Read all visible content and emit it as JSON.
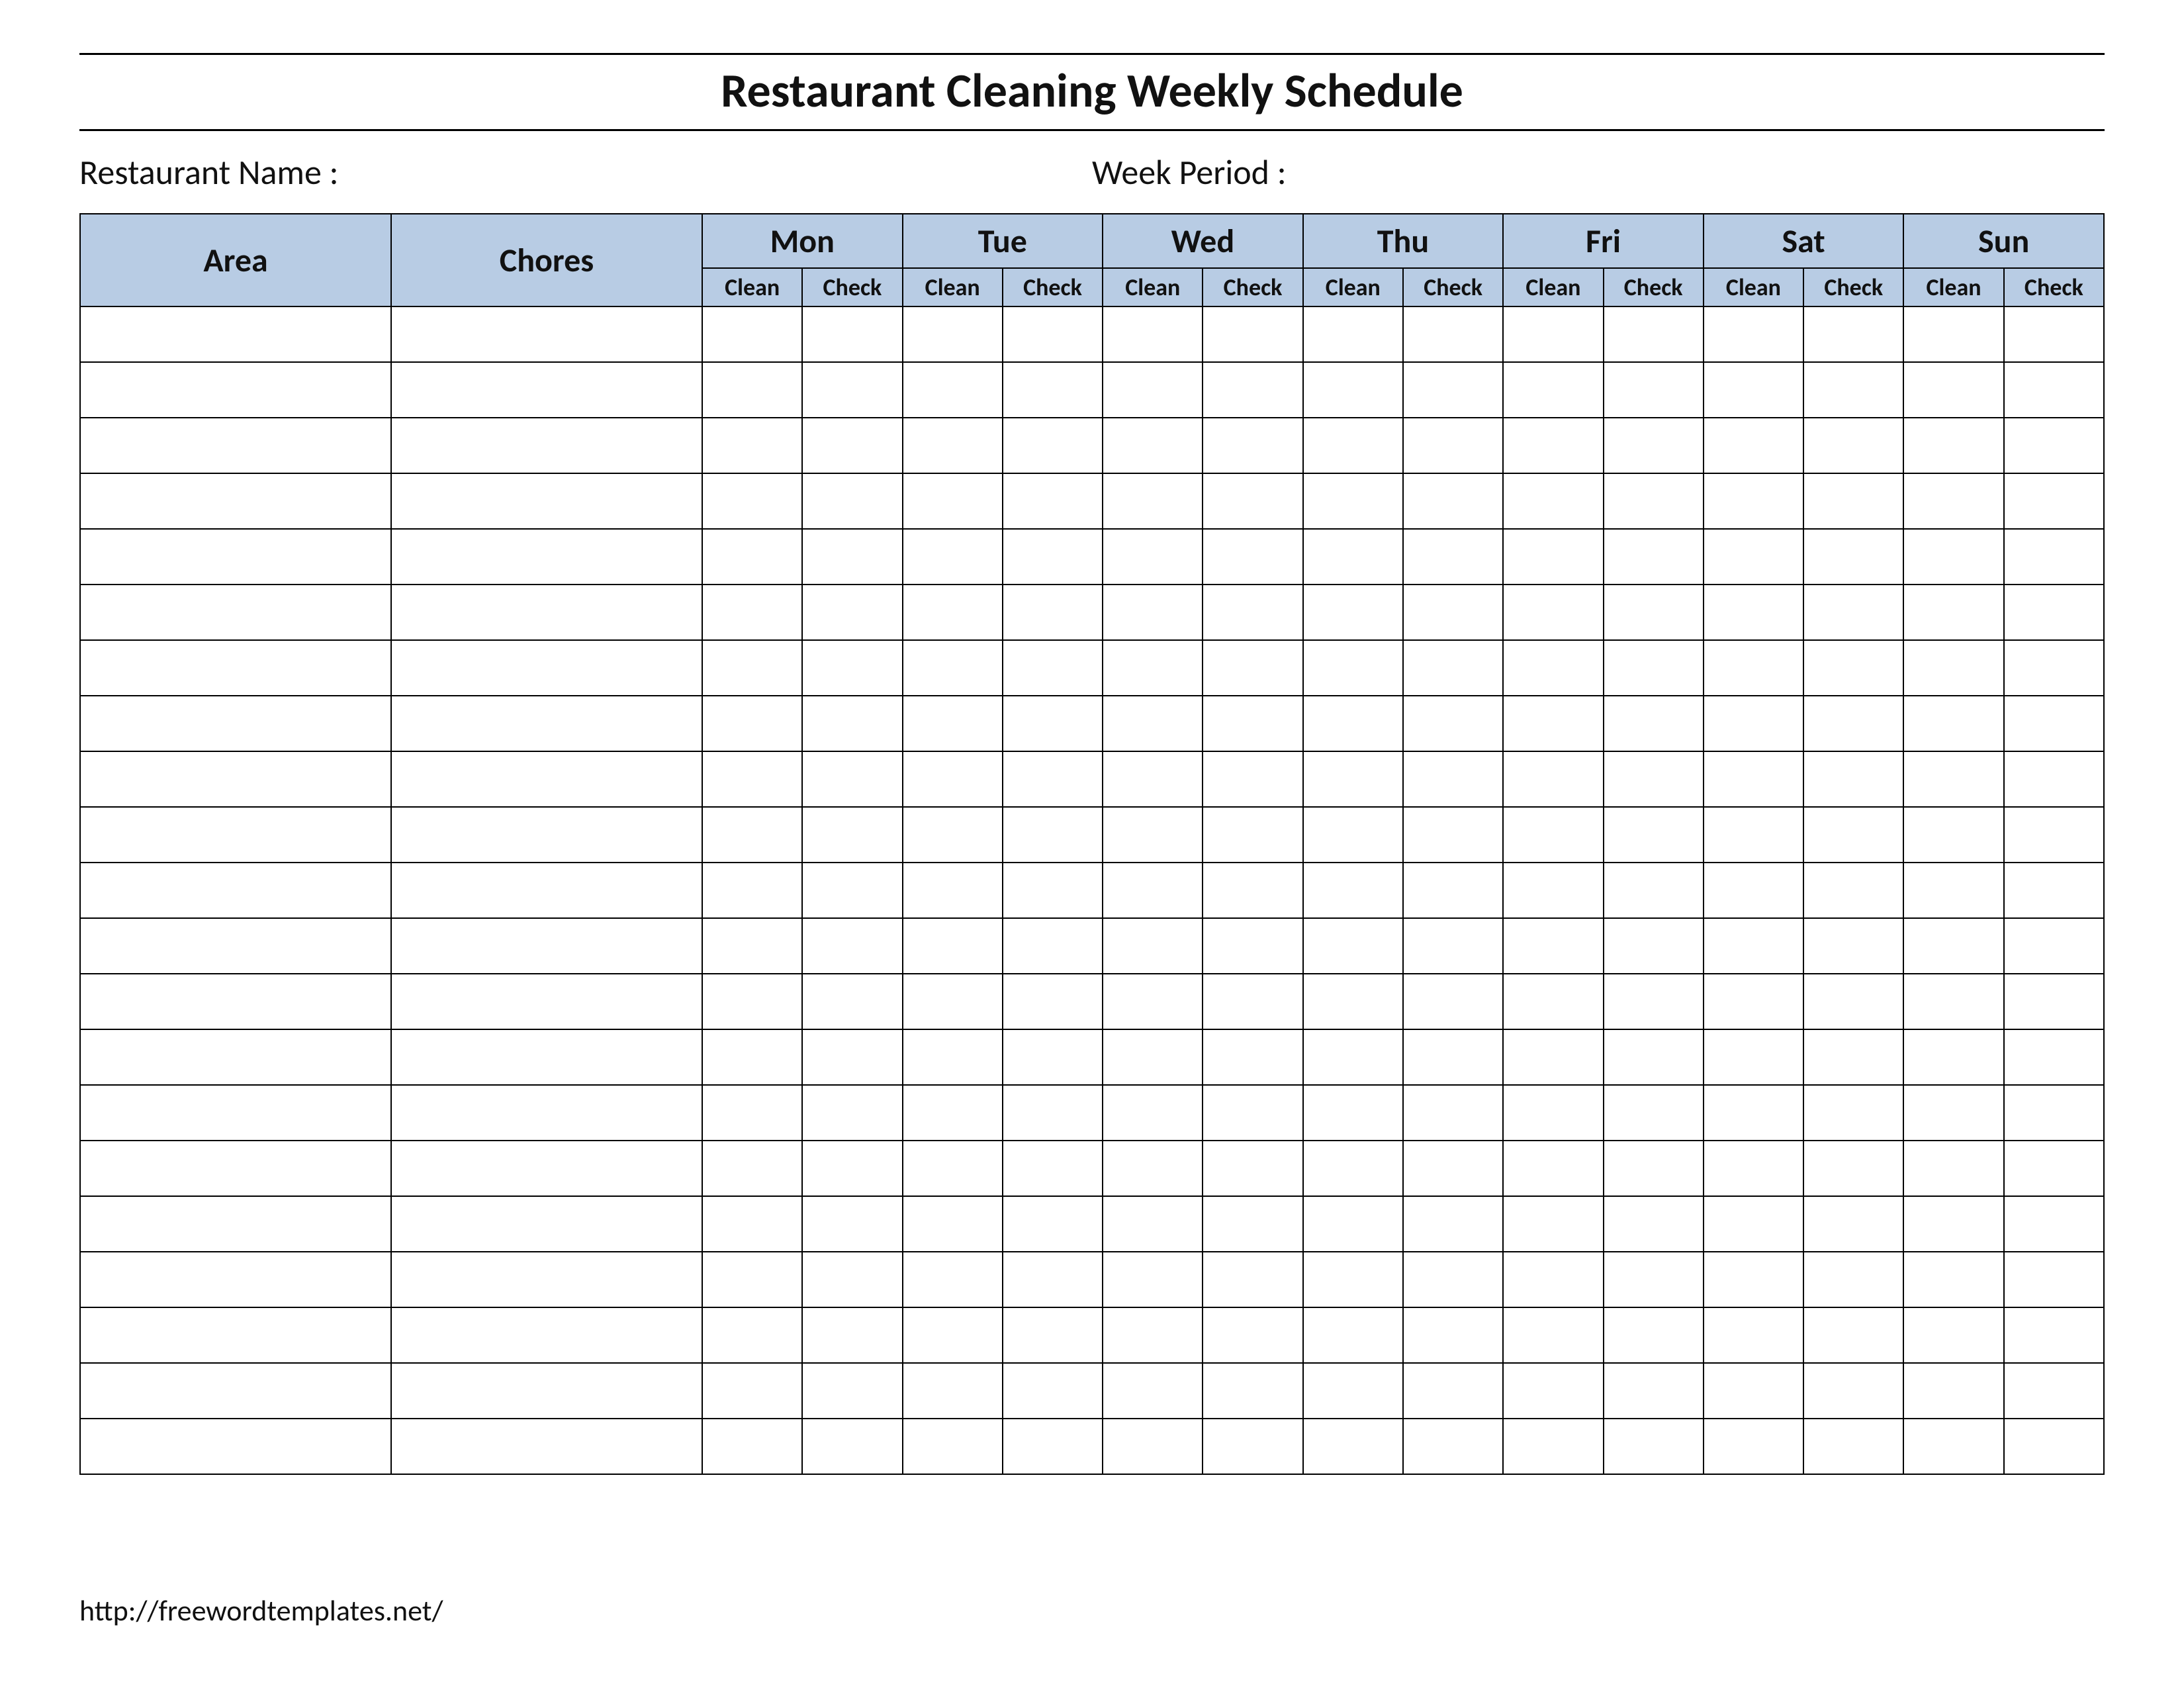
{
  "title": "Restaurant Cleaning Weekly Schedule",
  "fields": {
    "restaurant_name_label": "Restaurant Name   :",
    "week_period_label": "Week  Period :"
  },
  "columns": {
    "area": "Area",
    "chores": "Chores",
    "days": [
      "Mon",
      "Tue",
      "Wed",
      "Thu",
      "Fri",
      "Sat",
      "Sun"
    ],
    "sub": {
      "clean": "Clean",
      "check": "Check"
    }
  },
  "body_row_count": 21,
  "footer_url": "http://freewordtemplates.net/",
  "colors": {
    "header_bg": "#b8cce4",
    "border": "#000000"
  }
}
